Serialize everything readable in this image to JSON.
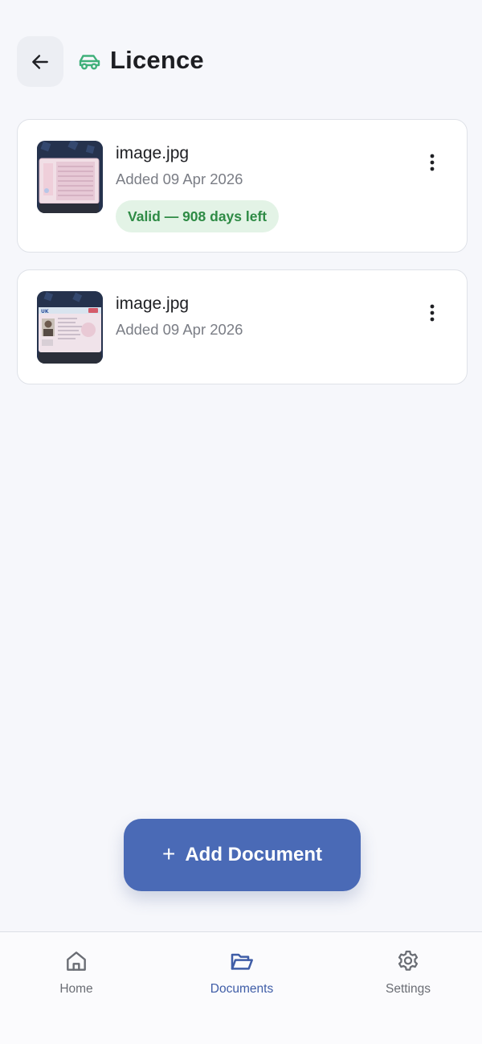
{
  "header": {
    "title": "Licence",
    "back_icon": "arrow-left-icon",
    "category_icon": "car-icon"
  },
  "documents": [
    {
      "filename": "image.jpg",
      "added": "Added 09 Apr 2026",
      "status": "Valid — 908 days left",
      "thumbnail": "licence-back-photo"
    },
    {
      "filename": "image.jpg",
      "added": "Added 09 Apr 2026",
      "thumbnail": "licence-front-photo"
    }
  ],
  "add_button": {
    "icon": "+",
    "label": "Add Document"
  },
  "nav": {
    "items": [
      {
        "label": "Home",
        "icon": "home-icon"
      },
      {
        "label": "Documents",
        "icon": "folder-open-icon",
        "active": true
      },
      {
        "label": "Settings",
        "icon": "gear-icon"
      }
    ]
  },
  "colors": {
    "accent": "#4a6ab6",
    "valid_text": "#2e8b45",
    "valid_bg": "#e3f3e6",
    "car_icon": "#3fb07a"
  }
}
